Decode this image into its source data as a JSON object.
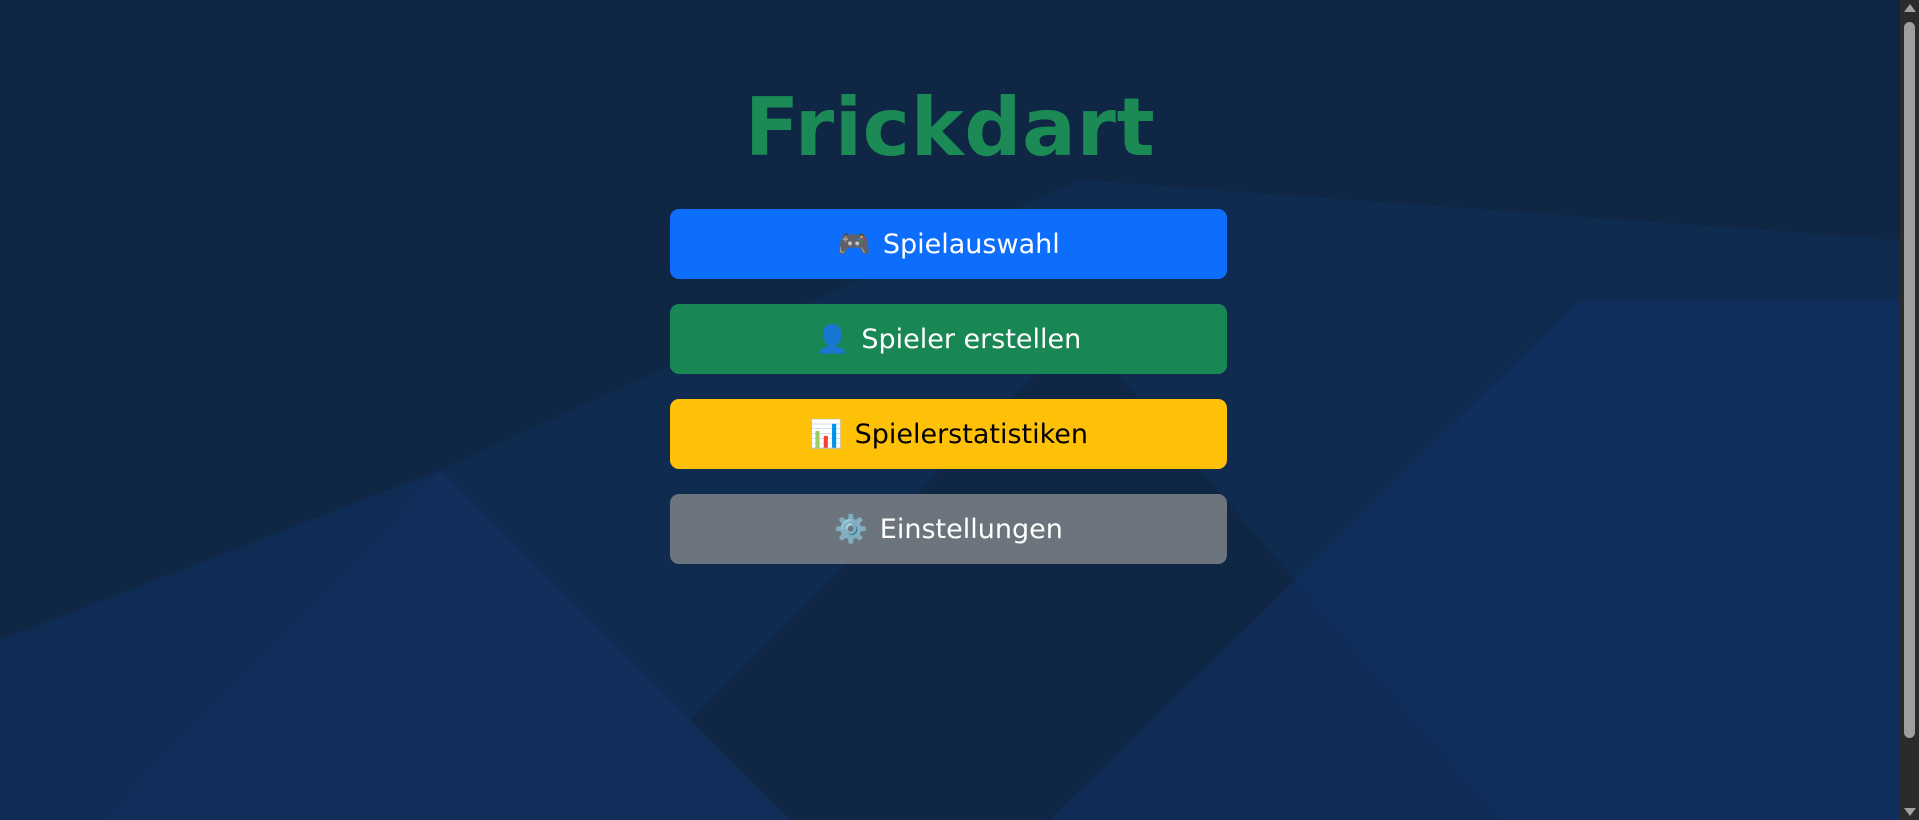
{
  "app": {
    "title": "Frickdart",
    "title_color": "#1b8a55"
  },
  "menu": {
    "items": [
      {
        "label": "Spielauswahl",
        "icon": "gamepad-icon",
        "glyph": "🎮",
        "bg_color": "#0d6efd",
        "text_color": "#ffffff"
      },
      {
        "label": "Spieler erstellen",
        "icon": "user-icon",
        "glyph": "👤",
        "bg_color": "#198754",
        "text_color": "#ffffff"
      },
      {
        "label": "Spielerstatistiken",
        "icon": "bar-chart-icon",
        "glyph": "📊",
        "bg_color": "#ffc107",
        "text_color": "#000000"
      },
      {
        "label": "Einstellungen",
        "icon": "gear-icon",
        "glyph": "⚙️",
        "bg_color": "#6c757d",
        "text_color": "#ffffff"
      }
    ]
  },
  "theme": {
    "background": "#10284a"
  }
}
